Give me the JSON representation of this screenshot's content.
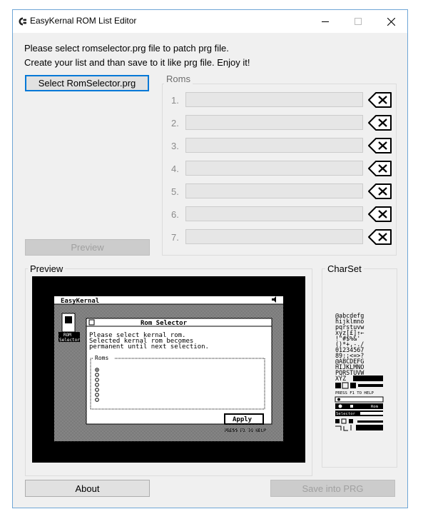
{
  "window": {
    "title": "EasyKernal ROM List Editor"
  },
  "intro": {
    "line1": "Please select romselector.prg file to patch prg file.",
    "line2": "Create your list and than save to it like prg file. Enjoy it!"
  },
  "buttons": {
    "select": "Select RomSelector.prg",
    "preview": "Preview",
    "about": "About",
    "save": "Save into PRG"
  },
  "roms_group": {
    "label": "Roms",
    "items": [
      {
        "num": "1.",
        "value": ""
      },
      {
        "num": "2.",
        "value": ""
      },
      {
        "num": "3.",
        "value": ""
      },
      {
        "num": "4.",
        "value": ""
      },
      {
        "num": "5.",
        "value": ""
      },
      {
        "num": "6.",
        "value": ""
      },
      {
        "num": "7.",
        "value": ""
      }
    ]
  },
  "preview_group": {
    "label": "Preview"
  },
  "charset_group": {
    "label": "CharSet"
  },
  "c64_preview": {
    "menubar": "EasyKernal",
    "icon_label_1": "ROM",
    "icon_label_2": "Selector",
    "dialog_title": "Rom  Selector",
    "msg1": "Please select kernal rom.",
    "msg2": "Selected kernal rom becomes",
    "msg3": "permanent until next selection.",
    "roms_label": "Roms",
    "apply": "Apply",
    "hint": "PRESS F1 TO HELP"
  },
  "charset_text": {
    "r1": "@abcdefg",
    "r2": "hijklmno",
    "r3": "pqrstuvw",
    "r4": "xyz[£]↑←",
    "r5": " !\"#$%&'",
    "r6": "()*+,-./",
    "r7": "01234567",
    "r8": "89:;<=>?",
    "r9": "@ABCDEFG",
    "r10": "HIJKLMNO",
    "r11": "PQRSTUVW",
    "r12": "XYZ",
    "r13": "PRESS F1 TO HELP",
    "r14": "Selector",
    "r15": "Rom"
  },
  "colors": {
    "focus": "#0078d7",
    "c64_bg": "#000000",
    "c64_fg": "#ffffff"
  }
}
